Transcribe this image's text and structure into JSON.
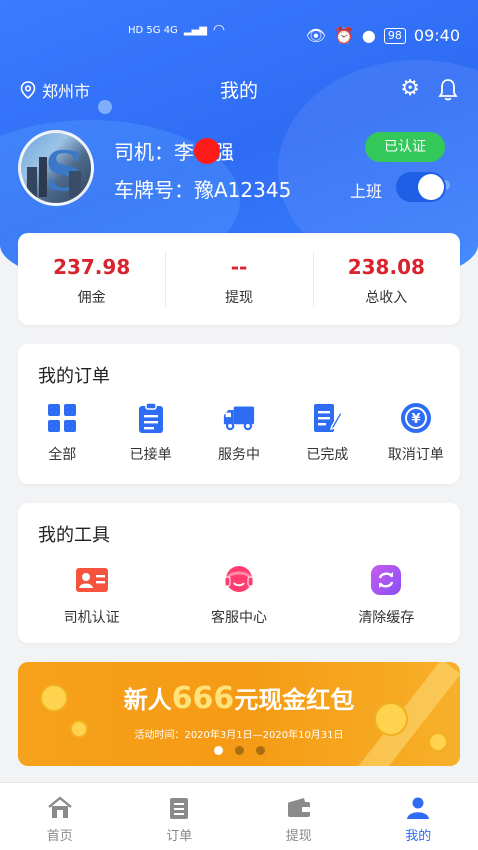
{
  "status_bar": {
    "network_left": "HD 5G 4G",
    "time": "09:40",
    "battery": "98"
  },
  "header": {
    "city": "郑州市",
    "title": "我的",
    "settings_icon": "gear-icon",
    "notification_icon": "bell-icon"
  },
  "profile": {
    "driver_label": "司机：李",
    "driver_name_suffix": "强",
    "plate_label": "车牌号：豫A12345",
    "verified_badge": "已认证",
    "shift_label": "上班",
    "shift_on": true
  },
  "earnings": [
    {
      "value": "237.98",
      "label": "佣金"
    },
    {
      "value": "--",
      "label": "提现"
    },
    {
      "value": "238.08",
      "label": "总收入"
    }
  ],
  "orders": {
    "title": "我的订单",
    "items": [
      {
        "label": "全部",
        "icon": "grid-icon"
      },
      {
        "label": "已接单",
        "icon": "clipboard-icon"
      },
      {
        "label": "服务中",
        "icon": "truck-icon"
      },
      {
        "label": "已完成",
        "icon": "document-edit-icon"
      },
      {
        "label": "取消订单",
        "icon": "yuan-cancel-icon"
      }
    ]
  },
  "tools": {
    "title": "我的工具",
    "items": [
      {
        "label": "司机认证",
        "icon": "id-card-icon"
      },
      {
        "label": "客服中心",
        "icon": "headset-icon"
      },
      {
        "label": "清除缓存",
        "icon": "refresh-icon"
      }
    ]
  },
  "banner": {
    "title_prefix": "新人",
    "title_amount": "666",
    "title_suffix": "元现金红包",
    "subtitle": "活动时间：2020年3月1日—2020年10月31日",
    "active_dot": 0
  },
  "bottom_nav": [
    {
      "label": "首页",
      "icon": "home-icon"
    },
    {
      "label": "订单",
      "icon": "list-icon"
    },
    {
      "label": "提现",
      "icon": "wallet-icon"
    },
    {
      "label": "我的",
      "icon": "user-icon",
      "active": true
    }
  ],
  "colors": {
    "primary": "#2f6cf4",
    "earning_red": "#d9232d",
    "verified_green": "#34c759",
    "banner_orange": "#f7a21b"
  }
}
